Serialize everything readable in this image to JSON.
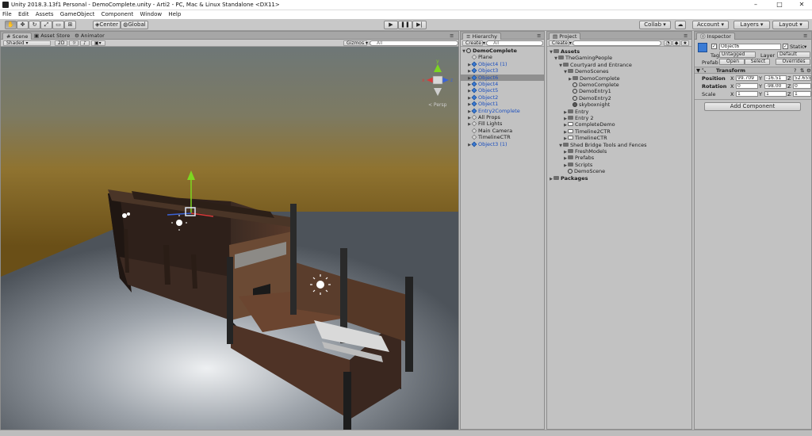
{
  "window": {
    "title": "Unity 2018.3.13f1 Personal - DemoComplete.unity - Arti2 - PC, Mac & Linux Standalone <DX11>",
    "minimize": "–",
    "maximize": "□",
    "close": "✕"
  },
  "menu": [
    "File",
    "Edit",
    "Assets",
    "GameObject",
    "Component",
    "Window",
    "Help"
  ],
  "toolbar": {
    "pivot": "Center",
    "space": "Global",
    "collab": "Collab ▾",
    "account": "Account ▾",
    "layers": "Layers ▾",
    "layout": "Layout ▾"
  },
  "scene": {
    "tabs": [
      "Scene",
      "Asset Store",
      "Animator"
    ],
    "shading": "Shaded",
    "mode2d": "2D",
    "gizmos": "Gizmos ▾",
    "search_placeholder": "All",
    "persp_label": "< Persp",
    "axis_x": "x",
    "axis_y": "y",
    "axis_z": "z"
  },
  "hierarchy": {
    "tab": "Hierarchy",
    "create": "Create ▾",
    "search_placeholder": "All",
    "scene_name": "DemoComplete",
    "items": [
      {
        "label": "Plane",
        "blue": false,
        "arrow": false
      },
      {
        "label": "Object4 (1)",
        "blue": true,
        "arrow": true
      },
      {
        "label": "Object3",
        "blue": true,
        "arrow": true
      },
      {
        "label": "Object6",
        "blue": true,
        "arrow": true,
        "selected": true
      },
      {
        "label": "Object4",
        "blue": true,
        "arrow": true
      },
      {
        "label": "Object5",
        "blue": true,
        "arrow": true
      },
      {
        "label": "Object2",
        "blue": true,
        "arrow": true
      },
      {
        "label": "Object1",
        "blue": true,
        "arrow": true
      },
      {
        "label": "Entry2Complete",
        "blue": true,
        "arrow": true
      },
      {
        "label": "All Props",
        "blue": false,
        "arrow": true
      },
      {
        "label": "Fill Lights",
        "blue": false,
        "arrow": true
      },
      {
        "label": "Main Camera",
        "blue": false,
        "arrow": false
      },
      {
        "label": "TimelineCTR",
        "blue": false,
        "arrow": false
      },
      {
        "label": "Object3 (1)",
        "blue": true,
        "arrow": true
      }
    ]
  },
  "project": {
    "tab": "Project",
    "create": "Create ▾",
    "items": [
      {
        "label": "Assets",
        "bold": true,
        "type": "folder",
        "arrow": "▼"
      },
      {
        "label": "TheGamingPeople",
        "type": "folder",
        "arrow": "▼"
      },
      {
        "label": "Courtyard and Entrance",
        "type": "folder",
        "arrow": "▼"
      },
      {
        "label": "DemoScenes",
        "type": "folder",
        "arrow": "▼"
      },
      {
        "label": "DemoComplete",
        "type": "folder",
        "arrow": "▶"
      },
      {
        "label": "DemoComplete",
        "type": "unity",
        "arrow": ""
      },
      {
        "label": "DemoEntry1",
        "type": "unity",
        "arrow": ""
      },
      {
        "label": "DemoEntry2",
        "type": "unity",
        "arrow": ""
      },
      {
        "label": "skyboxnight",
        "type": "sphere",
        "arrow": ""
      },
      {
        "label": "Entry",
        "type": "folder",
        "arrow": "▶"
      },
      {
        "label": "Entry 2",
        "type": "folder",
        "arrow": "▶"
      },
      {
        "label": "CompleteDemo",
        "type": "file",
        "arrow": "▶"
      },
      {
        "label": "Timeline2CTR",
        "type": "file",
        "arrow": "▶"
      },
      {
        "label": "TimelineCTR",
        "type": "file",
        "arrow": "▶"
      },
      {
        "label": "Shed Bridge Tools and Fences",
        "type": "folder",
        "arrow": "▼"
      },
      {
        "label": "FreshModels",
        "type": "folder",
        "arrow": "▶"
      },
      {
        "label": "Prefabs",
        "type": "folder",
        "arrow": "▶"
      },
      {
        "label": "Scripts",
        "type": "folder",
        "arrow": "▶"
      },
      {
        "label": "DemoScene",
        "type": "unity",
        "arrow": ""
      },
      {
        "label": "Packages",
        "bold": true,
        "type": "folder",
        "arrow": "▶"
      }
    ]
  },
  "inspector": {
    "tab": "Inspector",
    "object_name": "Object6",
    "static_label": "Static",
    "tag_label": "Tag",
    "tag_value": "Untagged",
    "layer_label": "Layer",
    "layer_value": "Default",
    "prefab_label": "Prefab",
    "open": "Open",
    "select": "Select",
    "overrides": "Overrides",
    "transform_title": "Transform",
    "position_label": "Position",
    "rotation_label": "Rotation",
    "scale_label": "Scale",
    "pos_x": "99.709",
    "pos_y": "-16.51",
    "pos_z": "52.655",
    "rot_x": "0",
    "rot_y": "-98.00",
    "rot_z": "0",
    "scale_x": "1",
    "scale_y": "1",
    "scale_z": "1",
    "x": "X",
    "y": "Y",
    "z": "Z",
    "add_component": "Add Component"
  }
}
